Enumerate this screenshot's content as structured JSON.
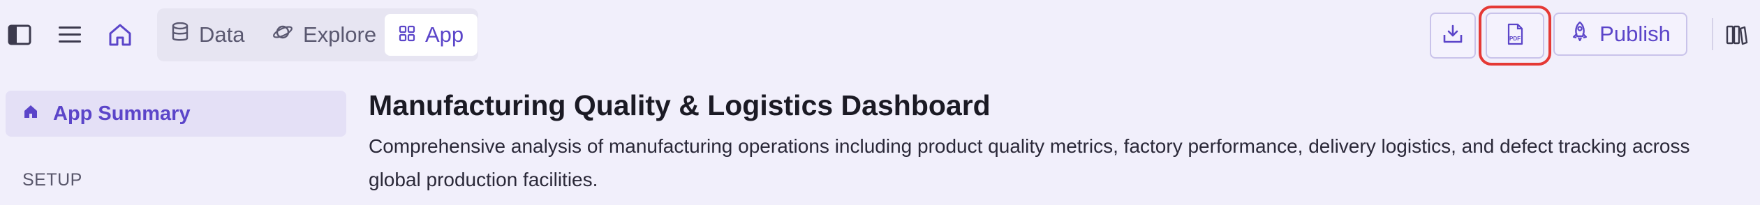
{
  "toolbar": {
    "icons": [
      "sidebar-toggle-icon",
      "menu-icon",
      "home-icon"
    ],
    "tabs": [
      {
        "label": "Data",
        "icon": "database-icon",
        "active": false
      },
      {
        "label": "Explore",
        "icon": "planet-icon",
        "active": false
      },
      {
        "label": "App",
        "icon": "grid-icon",
        "active": true
      }
    ],
    "download_icon": "download-icon",
    "pdf_icon": "pdf-icon",
    "publish_label": "Publish",
    "publish_icon": "rocket-icon",
    "library_icon": "books-icon"
  },
  "sidebar": {
    "items": [
      {
        "label": "App Summary",
        "icon": "home-icon",
        "active": true
      }
    ],
    "section_heading": "SETUP"
  },
  "main": {
    "title": "Manufacturing Quality & Logistics Dashboard",
    "description": "Comprehensive analysis of manufacturing operations including product quality metrics, factory performance, delivery logistics, and defect tracking across global production facilities."
  },
  "colors": {
    "accent": "#5b45c9",
    "background": "#f1effb",
    "highlight_outline": "#e53935"
  }
}
